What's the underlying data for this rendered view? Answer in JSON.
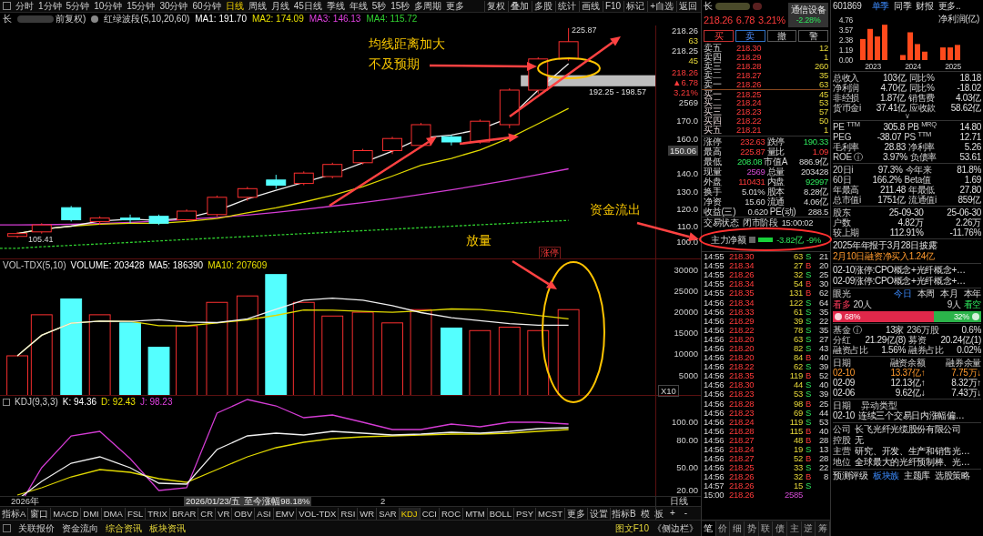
{
  "toolbar": {
    "periods": [
      {
        "label": "分时",
        "selected": false
      },
      {
        "label": "1分钟",
        "selected": false
      },
      {
        "label": "5分钟",
        "selected": false
      },
      {
        "label": "10分钟",
        "selected": false
      },
      {
        "label": "15分钟",
        "selected": false
      },
      {
        "label": "30分钟",
        "selected": false
      },
      {
        "label": "60分钟",
        "selected": false
      },
      {
        "label": "日线",
        "selected": true
      },
      {
        "label": "周线",
        "selected": false
      },
      {
        "label": "月线",
        "selected": false
      },
      {
        "label": "45日线",
        "selected": false
      },
      {
        "label": "季线",
        "selected": false
      },
      {
        "label": "年线",
        "selected": false
      },
      {
        "label": "5秒",
        "selected": false
      },
      {
        "label": "15秒",
        "selected": false
      },
      {
        "label": "多周期",
        "selected": false
      },
      {
        "label": "更多",
        "selected": false
      }
    ],
    "tools": [
      "复权",
      "叠加",
      "多股",
      "统计",
      "画线",
      "F10",
      "标记",
      "+自选",
      "返回"
    ]
  },
  "legend": {
    "symbol": "长",
    "adjust": "前复权)",
    "indicator": "红绿波段(5,10,20,60)",
    "mas": [
      {
        "text": "MA1: 191.70",
        "color": "#ffffff"
      },
      {
        "text": "MA2: 174.09",
        "color": "#e8e000"
      },
      {
        "text": "MA3: 146.13",
        "color": "#e040e0"
      },
      {
        "text": "MA4: 115.72",
        "color": "#30d030"
      }
    ]
  },
  "price_axis": [
    {
      "text": "218.26",
      "kind": "flat"
    },
    {
      "text": "63",
      "kind": "volume"
    },
    {
      "text": "218.25",
      "kind": "flat"
    },
    {
      "text": "45",
      "kind": "volume"
    },
    {
      "text": "218.26",
      "kind": "up"
    },
    {
      "text": "▲6.78",
      "kind": "up"
    },
    {
      "text": "3.21%",
      "kind": "up"
    },
    {
      "text": "2569",
      "kind": "flat"
    },
    {
      "text": "170.0",
      "kind": "flat"
    },
    {
      "text": "160.0",
      "kind": "flat"
    },
    {
      "text": "150.06",
      "kind": "cursor"
    },
    {
      "text": "140.0",
      "kind": "flat"
    },
    {
      "text": "130.0",
      "kind": "flat"
    },
    {
      "text": "120.0",
      "kind": "flat"
    },
    {
      "text": "110.0",
      "kind": "flat"
    },
    {
      "text": "100.0",
      "kind": "flat"
    }
  ],
  "price_labels": {
    "high": "225.87",
    "low": "105.41",
    "band": "192.25 - 198.57",
    "limit": "涨停"
  },
  "annotations": [
    {
      "text": "均线距离加大"
    },
    {
      "text": "不及预期"
    },
    {
      "text": "资金流出"
    },
    {
      "text": "放量"
    }
  ],
  "volume": {
    "legend": [
      {
        "text": "VOL-TDX(5,10)"
      },
      {
        "text": "VOLUME: 203428",
        "color": "#ffffff"
      },
      {
        "text": "MA5: 186390",
        "color": "#ffffff"
      },
      {
        "text": "MA10: 207609",
        "color": "#e8e000"
      }
    ],
    "axis": [
      "30000",
      "25000",
      "20000",
      "15000",
      "10000",
      "5000",
      "X10"
    ]
  },
  "kdj": {
    "legend": [
      {
        "text": "KDJ(9,3,3)"
      },
      {
        "text": "K: 94.36",
        "color": "#ffffff"
      },
      {
        "text": "D: 92.43",
        "color": "#e8e000"
      },
      {
        "text": "J: 98.23",
        "color": "#e040e0"
      }
    ],
    "axis": [
      "100.00",
      "80.00",
      "50.00",
      "20.00"
    ]
  },
  "axis_footer": {
    "period": "日线",
    "buttons": [
      "+",
      "-"
    ]
  },
  "date_axis": {
    "year": "2026年",
    "cursor": "2026/01/23/五",
    "gain": "至今涨幅98.18%",
    "tick": "2"
  },
  "indicator_tabs": {
    "left": [
      {
        "label": "指标A",
        "selected": false
      },
      {
        "label": "窗口",
        "selected": false
      },
      {
        "label": "MACD",
        "selected": false
      },
      {
        "label": "DMI",
        "selected": false
      },
      {
        "label": "DMA",
        "selected": false
      },
      {
        "label": "FSL",
        "selected": false
      },
      {
        "label": "TRIX",
        "selected": false
      },
      {
        "label": "BRAR",
        "selected": false
      },
      {
        "label": "CR",
        "selected": false
      },
      {
        "label": "VR",
        "selected": false
      },
      {
        "label": "OBV",
        "selected": false
      },
      {
        "label": "ASI",
        "selected": false
      },
      {
        "label": "EMV",
        "selected": false
      },
      {
        "label": "VOL-TDX",
        "selected": false
      },
      {
        "label": "RSI",
        "selected": false
      },
      {
        "label": "WR",
        "selected": false
      },
      {
        "label": "SAR",
        "selected": false
      },
      {
        "label": "KDJ",
        "selected": true
      },
      {
        "label": "CCI",
        "selected": false
      },
      {
        "label": "ROC",
        "selected": false
      },
      {
        "label": "MTM",
        "selected": false
      },
      {
        "label": "BOLL",
        "selected": false
      },
      {
        "label": "PSY",
        "selected": false
      },
      {
        "label": "MCST",
        "selected": false
      },
      {
        "label": "更多",
        "selected": false
      },
      {
        "label": "设置",
        "selected": false
      }
    ],
    "right": [
      "指标B",
      "模",
      "板"
    ]
  },
  "status_bar": {
    "items": [
      {
        "label": "关联报价",
        "highlight": false
      },
      {
        "label": "资金流向",
        "highlight": false
      },
      {
        "label": "综合资讯",
        "highlight": true
      },
      {
        "label": "板块资讯",
        "highlight": true
      }
    ],
    "right": "图文F10",
    "sidebar": "《侧边栏》"
  },
  "quote": {
    "symbol": "长",
    "price": "218.26",
    "change": "6.78",
    "percent": "3.21%",
    "sector": {
      "name": "通信设备",
      "change": "-2.28%"
    },
    "buttons": [
      {
        "label": "买",
        "kind": "buy"
      },
      {
        "label": "卖",
        "kind": "sell"
      },
      {
        "label": "撤",
        "kind": "plain"
      },
      {
        "label": "警",
        "kind": "plain"
      }
    ],
    "book": [
      {
        "label": "卖五",
        "price": "218.30",
        "volume": "12",
        "kind": "sell"
      },
      {
        "label": "卖四",
        "price": "218.29",
        "volume": "1",
        "kind": "sell"
      },
      {
        "label": "卖三",
        "price": "218.28",
        "volume": "260",
        "kind": "sell"
      },
      {
        "label": "卖二",
        "price": "218.27",
        "volume": "35",
        "kind": "sell"
      },
      {
        "label": "卖一",
        "price": "218.26",
        "volume": "63",
        "kind": "sell"
      },
      {
        "label": "买一",
        "price": "218.25",
        "volume": "45",
        "kind": "buy"
      },
      {
        "label": "买二",
        "price": "218.24",
        "volume": "53",
        "kind": "buy"
      },
      {
        "label": "买三",
        "price": "218.23",
        "volume": "57",
        "kind": "buy"
      },
      {
        "label": "买四",
        "price": "218.22",
        "volume": "50",
        "kind": "buy"
      },
      {
        "label": "买五",
        "price": "218.21",
        "volume": "1",
        "kind": "buy"
      }
    ],
    "stats": [
      [
        {
          "label": "涨停",
          "value": "232.63",
          "kind": "up"
        },
        {
          "label": "跌停",
          "value": "190.33",
          "kind": "down"
        }
      ],
      [
        {
          "label": "最高",
          "value": "225.87",
          "kind": "up"
        },
        {
          "label": "量比",
          "value": "1.09",
          "kind": "up"
        }
      ],
      [
        {
          "label": "最低",
          "value": "208.08",
          "kind": "down"
        },
        {
          "label": "市值A",
          "value": "886.9亿",
          "kind": "flat"
        }
      ],
      [
        {
          "label": "现量",
          "value": "2569",
          "kind": "hot"
        },
        {
          "label": "总量",
          "value": "203428",
          "kind": "flat"
        }
      ],
      [
        {
          "label": "外盘",
          "value": "110431",
          "kind": "up"
        },
        {
          "label": "内盘",
          "value": "92997",
          "kind": "down"
        }
      ],
      [
        {
          "label": "换手",
          "value": "5.01%",
          "kind": "flat"
        },
        {
          "label": "股本",
          "value": "8.28亿",
          "kind": "flat"
        }
      ],
      [
        {
          "label": "净资",
          "value": "15.60",
          "kind": "flat"
        },
        {
          "label": "流通",
          "value": "4.06亿",
          "kind": "flat"
        }
      ],
      [
        {
          "label": "收益(三)",
          "value": "0.620",
          "kind": "flat"
        },
        {
          "label": "PE(动)",
          "value": "288.5",
          "kind": "flat"
        }
      ]
    ],
    "status": {
      "label": "交易状态",
      "phase": "闭市阶段",
      "time": "15:00:02"
    },
    "main_force": {
      "label": "主力净额",
      "amount": "-3.82亿",
      "percent": "-9%"
    },
    "ticks": [
      {
        "time": "14:55",
        "price": "218.30",
        "volume": "63",
        "side": "S",
        "kind": "sell",
        "count": "21"
      },
      {
        "time": "14:55",
        "price": "218.34",
        "volume": "27",
        "side": "B",
        "kind": "buy",
        "count": "20"
      },
      {
        "time": "14:55",
        "price": "218.26",
        "volume": "32",
        "side": "S",
        "kind": "sell",
        "count": "25"
      },
      {
        "time": "14:55",
        "price": "218.34",
        "volume": "54",
        "side": "B",
        "kind": "buy",
        "count": "30"
      },
      {
        "time": "14:55",
        "price": "218.35",
        "volume": "131",
        "side": "B",
        "kind": "buy",
        "count": "62"
      },
      {
        "time": "14:56",
        "price": "218.34",
        "volume": "122",
        "side": "S",
        "kind": "sell",
        "count": "64"
      },
      {
        "time": "14:56",
        "price": "218.33",
        "volume": "61",
        "side": "S",
        "kind": "sell",
        "count": "35"
      },
      {
        "time": "14:56",
        "price": "218.29",
        "volume": "39",
        "side": "S",
        "kind": "sell",
        "count": "22"
      },
      {
        "time": "14:56",
        "price": "218.22",
        "volume": "78",
        "side": "S",
        "kind": "sell",
        "count": "35"
      },
      {
        "time": "14:56",
        "price": "218.20",
        "volume": "63",
        "side": "S",
        "kind": "sell",
        "count": "27"
      },
      {
        "time": "14:56",
        "price": "218.20",
        "volume": "82",
        "side": "S",
        "kind": "sell",
        "count": "43"
      },
      {
        "time": "14:56",
        "price": "218.20",
        "volume": "84",
        "side": "B",
        "kind": "buy",
        "count": "40"
      },
      {
        "time": "14:56",
        "price": "218.22",
        "volume": "62",
        "side": "S",
        "kind": "sell",
        "count": "39"
      },
      {
        "time": "14:56",
        "price": "218.35",
        "volume": "119",
        "side": "B",
        "kind": "buy",
        "count": "52"
      },
      {
        "time": "14:56",
        "price": "218.30",
        "volume": "44",
        "side": "S",
        "kind": "sell",
        "count": "40"
      },
      {
        "time": "14:56",
        "price": "218.23",
        "volume": "53",
        "side": "S",
        "kind": "sell",
        "count": "39"
      },
      {
        "time": "14:56",
        "price": "218.28",
        "volume": "98",
        "side": "B",
        "kind": "buy",
        "count": "25"
      },
      {
        "time": "14:56",
        "price": "218.23",
        "volume": "69",
        "side": "S",
        "kind": "sell",
        "count": "44"
      },
      {
        "time": "14:56",
        "price": "218.24",
        "volume": "119",
        "side": "S",
        "kind": "sell",
        "count": "53"
      },
      {
        "time": "14:56",
        "price": "218.28",
        "volume": "115",
        "side": "B",
        "kind": "buy",
        "count": "40"
      },
      {
        "time": "14:56",
        "price": "218.27",
        "volume": "48",
        "side": "B",
        "kind": "buy",
        "count": "28"
      },
      {
        "time": "14:56",
        "price": "218.24",
        "volume": "19",
        "side": "S",
        "kind": "sell",
        "count": "13"
      },
      {
        "time": "14:56",
        "price": "218.27",
        "volume": "52",
        "side": "B",
        "kind": "buy",
        "count": "28"
      },
      {
        "time": "14:56",
        "price": "218.25",
        "volume": "33",
        "side": "S",
        "kind": "sell",
        "count": "22"
      },
      {
        "time": "14:56",
        "price": "218.26",
        "volume": "32",
        "side": "B",
        "kind": "buy",
        "count": "8"
      },
      {
        "time": "14:57",
        "price": "218.26",
        "volume": "15",
        "side": "S",
        "kind": "sell"
      },
      {
        "time": "15:00",
        "price": "218.26",
        "volume": "2585",
        "kind": "auction"
      }
    ],
    "tabs": [
      {
        "label": "笔",
        "selected": true
      },
      {
        "label": "价",
        "selected": false
      },
      {
        "label": "细",
        "selected": false
      },
      {
        "label": "势",
        "selected": false
      },
      {
        "label": "联",
        "selected": false
      },
      {
        "label": "债",
        "selected": false
      },
      {
        "label": "主",
        "selected": false
      },
      {
        "label": "逆",
        "selected": false
      },
      {
        "label": "筹",
        "selected": false
      }
    ]
  },
  "fin": {
    "code": "601869",
    "tabs": [
      {
        "label": "单季",
        "selected": true
      },
      {
        "label": "同季",
        "selected": false
      },
      {
        "label": "财报",
        "selected": false
      },
      {
        "label": "更多..",
        "selected": false
      }
    ],
    "chart_data": {
      "type": "bar",
      "title": "净利润(亿)",
      "categories": [
        "2023",
        "2024",
        "2025"
      ],
      "series": [
        {
          "color": "#ff4a1c",
          "values": [
            2.5,
            0.6,
            1.5
          ]
        },
        {
          "color": "#ff4a1c",
          "values": [
            3.7,
            3.3,
            1.5
          ]
        },
        {
          "color": "#ff4a1c",
          "values": [
            2.8,
            1.9,
            1.8
          ]
        },
        {
          "color": "#ff4a1c",
          "values": [
            4.2,
            1.0,
            null
          ]
        }
      ],
      "ylim": [
        0,
        4.76
      ],
      "yticks": [
        {
          "value": 0,
          "label": "0.00"
        },
        {
          "value": 1.19,
          "label": "1.19"
        },
        {
          "value": 2.38,
          "label": "2.38"
        },
        {
          "value": 3.57,
          "label": "3.57"
        },
        {
          "value": 4.76,
          "label": "4.76"
        }
      ]
    },
    "metrics": [
      [
        "总收入",
        "103亿",
        "同比%",
        "18.18"
      ],
      [
        "净利润",
        "4.70亿",
        "同比%",
        "-18.02"
      ],
      [
        "非经损",
        "1.87亿",
        "销售费",
        "4.03亿"
      ],
      [
        "货币金i",
        "37.41亿",
        "应收款",
        "58.62亿"
      ]
    ],
    "more": "∨",
    "ratios": [
      [
        "PE $^{TTM}$",
        "305.8",
        "PB $^{MRQ}$",
        "14.80"
      ],
      [
        "PEG",
        "-38.07",
        "PS $^{TTM}$",
        "12.71"
      ],
      [
        "毛利率",
        "28.83",
        "净利率",
        "5.26"
      ],
      [
        "ROE ⓘ",
        "3.97%",
        "负债率",
        "53.61"
      ]
    ],
    "perf": [
      [
        "20日i",
        "97.3%",
        "今年来",
        "81.8%"
      ],
      [
        "60日",
        "166.2%",
        "Beta值",
        "1.69"
      ],
      [
        "年最高",
        "211.48",
        "年最低",
        "27.80"
      ],
      [
        "总市值i",
        "1751亿",
        "流通值i",
        "859亿"
      ]
    ],
    "holders": [
      [
        "股东",
        "25-09-30",
        "25-06-30"
      ],
      [
        "户数",
        "4.82万",
        "2.26万"
      ],
      [
        "较上期",
        "112.91%",
        "-11.76%"
      ]
    ],
    "notices": [
      {
        "text": "2025年年报于3月28日披露",
        "highlight": false
      },
      {
        "text": "2月10日融资净买入1.24亿",
        "highlight": true
      }
    ],
    "events": [
      "02-10涨停:CPO概念+光纤概念+…",
      "02-09涨停:CPO概念+光纤概念+…"
    ],
    "sentiment": {
      "title": "眼光",
      "periods": [
        {
          "label": "今日",
          "selected": true
        },
        {
          "label": "本周",
          "selected": false
        },
        {
          "label": "本月",
          "selected": false
        },
        {
          "label": "本年",
          "selected": false
        }
      ],
      "bull_label": "看多",
      "bull_count": "20人",
      "bear_count": "9人",
      "bear_label": "看空",
      "level": 0.68,
      "bull_pct": "68%",
      "bear_pct": "32%"
    },
    "holdings": [
      [
        "基金 ⓘ",
        "13家",
        "236万股",
        "0.6%"
      ],
      [
        "分红",
        "21.29亿(8)",
        "募资",
        "20.24亿(1)"
      ],
      [
        "融资占比",
        "1.56%",
        "融券占比",
        "0.02%"
      ]
    ],
    "margin": {
      "columns": [
        "日期",
        "融资余额",
        "融券余量"
      ],
      "rows": [
        {
          "cells": [
            "02-10",
            "13.37亿↑",
            "7.75万↓"
          ],
          "highlight": true
        },
        {
          "cells": [
            "02-09",
            "12.13亿↑",
            "8.32万↑"
          ],
          "highlight": false
        },
        {
          "cells": [
            "02-06",
            "9.62亿↓",
            "7.43万↓"
          ],
          "highlight": false
        }
      ]
    },
    "anomaly": {
      "columns": [
        "日期",
        "异动类型"
      ],
      "rows": [
        [
          "02-10",
          "连续三个交易日内涨幅偏…"
        ]
      ]
    },
    "company": [
      [
        "公司",
        "长飞光纤光缆股份有限公司"
      ],
      [
        "控股",
        "无"
      ],
      [
        "主营",
        "研究、开发、生产和销售光…"
      ],
      [
        "地位",
        "全球最大的光纤预制棒、光…"
      ]
    ],
    "links": [
      {
        "label": "预测评级",
        "selected": false
      },
      {
        "label": "板块族",
        "selected": true
      },
      {
        "label": "主题库",
        "selected": false
      },
      {
        "label": "选股策略",
        "selected": false
      }
    ]
  }
}
